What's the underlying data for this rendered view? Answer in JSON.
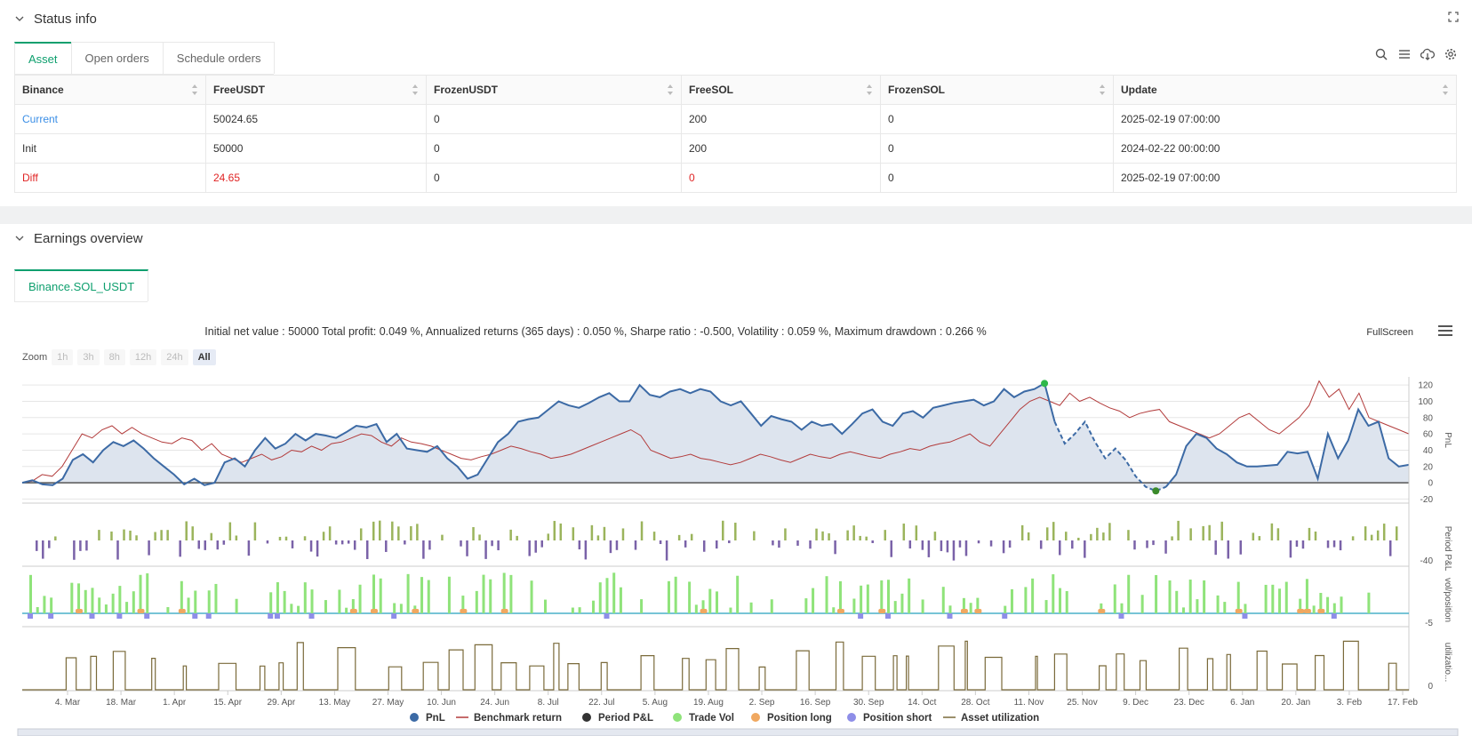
{
  "status": {
    "title": "Status info",
    "tabs": [
      "Asset",
      "Open orders",
      "Schedule orders"
    ],
    "table": {
      "headers": [
        "Binance",
        "FreeUSDT",
        "FrozenUSDT",
        "FreeSOL",
        "FrozenSOL",
        "Update"
      ],
      "rows": [
        [
          "Current",
          "50024.65",
          "0",
          "200",
          "0",
          "2025-02-19 07:00:00"
        ],
        [
          "Init",
          "50000",
          "0",
          "200",
          "0",
          "2024-02-22 00:00:00"
        ],
        [
          "Diff",
          "24.65",
          "0",
          "0",
          "0",
          "2025-02-19 07:00:00"
        ]
      ]
    }
  },
  "earnings": {
    "title": "Earnings overview",
    "tab": "Binance.SOL_USDT",
    "summary": "Initial net value : 50000 Total profit: 0.049 %, Annualized returns (365 days) : 0.050 %, Sharpe ratio : -0.500, Volatility : 0.059 %, Maximum drawdown : 0.266 %",
    "fullscreen": "FullScreen",
    "zoom_label": "Zoom",
    "zoom_buttons": [
      "1h",
      "3h",
      "8h",
      "12h",
      "24h",
      "All"
    ]
  },
  "chart_data": {
    "type": "line",
    "x_ticks": [
      "4. Mar",
      "18. Mar",
      "1. Apr",
      "15. Apr",
      "29. Apr",
      "13. May",
      "27. May",
      "10. Jun",
      "24. Jun",
      "8. Jul",
      "22. Jul",
      "5. Aug",
      "19. Aug",
      "2. Sep",
      "16. Sep",
      "30. Sep",
      "14. Oct",
      "28. Oct",
      "11. Nov",
      "25. Nov",
      "9. Dec",
      "23. Dec",
      "6. Jan",
      "20. Jan",
      "3. Feb",
      "17. Feb"
    ],
    "pnl_axis": {
      "label": "PnL",
      "ticks": [
        120,
        100,
        80,
        60,
        40,
        20,
        0,
        -20
      ]
    },
    "period_axis": {
      "label": "Period P&L",
      "ticks": [
        -40
      ]
    },
    "vol_axis": {
      "label": "vol/position",
      "ticks": [
        -5
      ]
    },
    "util_axis": {
      "label": "utilizatio...",
      "ticks": [
        0
      ]
    },
    "legend": [
      "PnL",
      "Benchmark return",
      "Period P&L",
      "Trade Vol",
      "Position long",
      "Position short",
      "Asset utilization"
    ],
    "colors": {
      "pnl": "#3c6aa5",
      "benchmark": "#b23b3b",
      "period_pos": "#9bb45c",
      "period_neg": "#7a62a8",
      "trade_vol": "#8fe37a",
      "pos_long": "#f0a860",
      "pos_short": "#8e8ee8",
      "utilization": "#7a6a3a"
    },
    "pnl": [
      0,
      3,
      -2,
      -3,
      5,
      28,
      35,
      25,
      40,
      50,
      45,
      52,
      42,
      30,
      20,
      10,
      -2,
      5,
      -3,
      0,
      25,
      30,
      20,
      40,
      55,
      42,
      48,
      60,
      52,
      60,
      58,
      55,
      62,
      70,
      68,
      72,
      50,
      60,
      42,
      40,
      38,
      45,
      30,
      20,
      5,
      10,
      30,
      50,
      60,
      75,
      78,
      80,
      90,
      100,
      95,
      92,
      98,
      105,
      110,
      100,
      100,
      120,
      108,
      105,
      112,
      115,
      110,
      115,
      112,
      100,
      95,
      100,
      85,
      70,
      82,
      78,
      75,
      65,
      75,
      70,
      72,
      60,
      72,
      85,
      90,
      75,
      70,
      85,
      88,
      80,
      92,
      95,
      98,
      100,
      102,
      95,
      100,
      115,
      105,
      112,
      115,
      122,
      75,
      48,
      60,
      75,
      50,
      30,
      42,
      28,
      8,
      -5,
      -10,
      -5,
      10,
      45,
      60,
      55,
      42,
      35,
      25,
      20,
      20,
      21,
      22,
      38,
      36,
      38,
      5,
      60,
      30,
      52,
      90,
      70,
      75,
      30,
      20,
      22
    ],
    "benchmark": [
      0,
      2,
      10,
      8,
      20,
      40,
      60,
      55,
      65,
      70,
      60,
      68,
      60,
      55,
      50,
      48,
      55,
      52,
      40,
      48,
      35,
      30,
      25,
      30,
      35,
      28,
      32,
      40,
      38,
      45,
      40,
      48,
      50,
      55,
      60,
      58,
      50,
      45,
      55,
      50,
      48,
      45,
      40,
      35,
      30,
      28,
      32,
      35,
      40,
      45,
      42,
      38,
      35,
      30,
      32,
      35,
      40,
      45,
      50,
      55,
      60,
      65,
      58,
      40,
      35,
      30,
      32,
      35,
      30,
      28,
      25,
      22,
      25,
      30,
      35,
      32,
      28,
      25,
      30,
      35,
      32,
      30,
      35,
      38,
      35,
      32,
      30,
      35,
      38,
      42,
      40,
      45,
      48,
      50,
      55,
      60,
      50,
      45,
      60,
      75,
      90,
      100,
      105,
      100,
      95,
      110,
      100,
      105,
      98,
      92,
      88,
      80,
      85,
      88,
      90,
      75,
      70,
      65,
      60,
      55,
      60,
      70,
      80,
      85,
      75,
      65,
      60,
      70,
      80,
      95,
      125,
      105,
      115,
      90,
      110,
      80,
      75,
      70,
      65,
      60
    ]
  }
}
